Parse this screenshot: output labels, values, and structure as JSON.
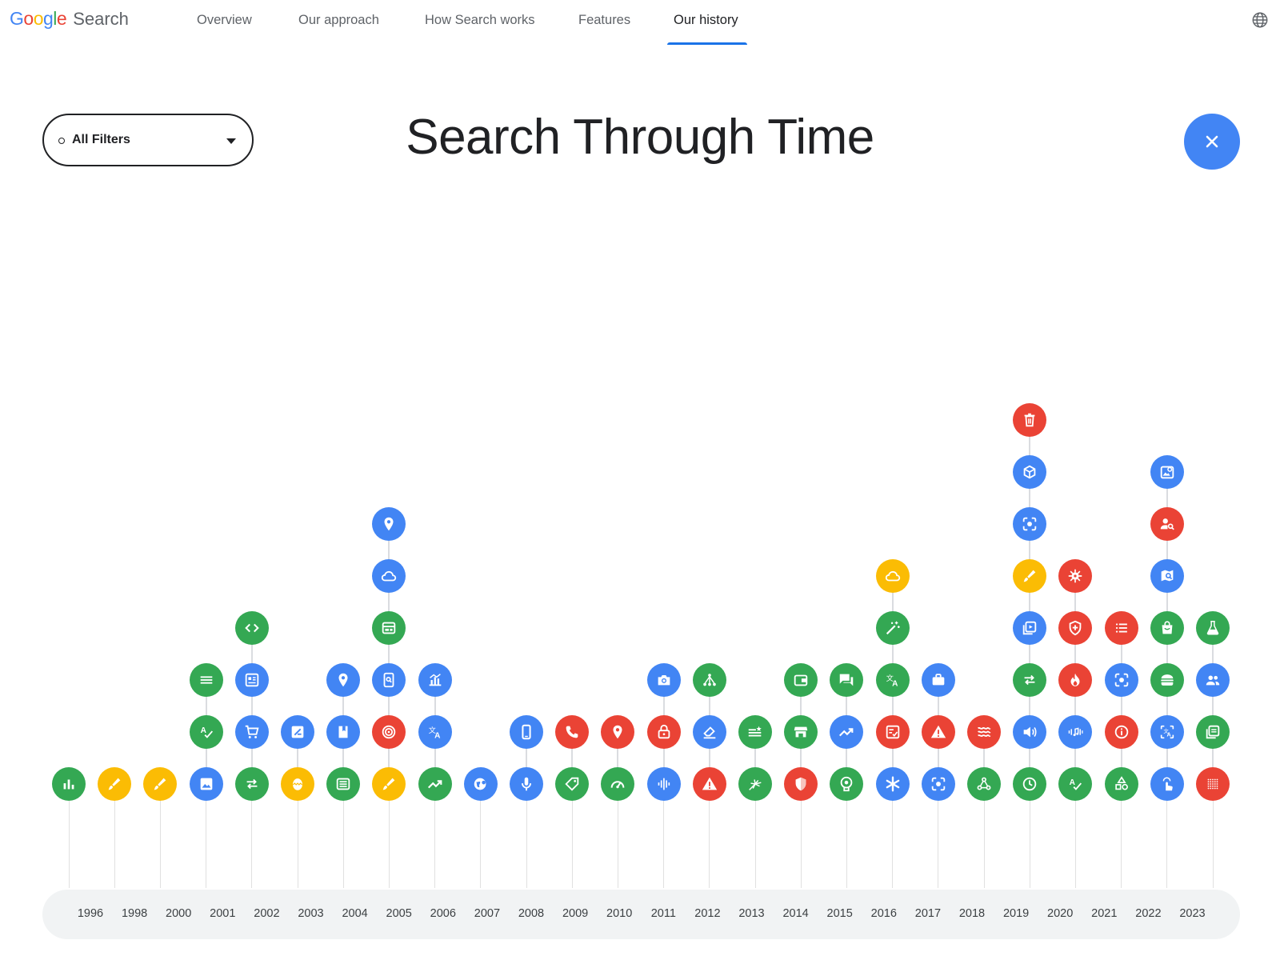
{
  "header": {
    "brand": {
      "letters": [
        "G",
        "o",
        "o",
        "g",
        "l",
        "e"
      ],
      "colors": [
        "#4285f4",
        "#ea4335",
        "#fbbc04",
        "#4285f4",
        "#34a853",
        "#ea4335"
      ],
      "product": "Search"
    },
    "nav": [
      {
        "label": "Overview",
        "active": false
      },
      {
        "label": "Our approach",
        "active": false
      },
      {
        "label": "How Search works",
        "active": false
      },
      {
        "label": "Features",
        "active": false
      },
      {
        "label": "Our history",
        "active": true
      }
    ],
    "accent": "#1a73e8",
    "globe_icon": "globe-icon"
  },
  "filter": {
    "label": "All Filters",
    "icon": "chevron-down-icon"
  },
  "page_title": "Search Through Time",
  "close_icon": "close-icon",
  "colors": {
    "green": "#34a853",
    "blue": "#4285f4",
    "yellow": "#fbbc04",
    "red": "#ea4335"
  },
  "timeline": {
    "columns": [
      {
        "year": "1996",
        "icons": [
          {
            "name": "bar-chart",
            "color": "green"
          }
        ]
      },
      {
        "year": "1998",
        "icons": [
          {
            "name": "brush",
            "color": "yellow"
          }
        ]
      },
      {
        "year": "2000",
        "icons": [
          {
            "name": "brush",
            "color": "yellow"
          }
        ]
      },
      {
        "year": "2001",
        "icons": [
          {
            "name": "image",
            "color": "blue"
          },
          {
            "name": "spellcheck",
            "color": "green"
          },
          {
            "name": "menu",
            "color": "green"
          }
        ]
      },
      {
        "year": "2002",
        "icons": [
          {
            "name": "swap",
            "color": "green"
          },
          {
            "name": "cart",
            "color": "blue"
          },
          {
            "name": "article",
            "color": "blue"
          },
          {
            "name": "code",
            "color": "green"
          }
        ]
      },
      {
        "year": "2003",
        "icons": [
          {
            "name": "egg",
            "color": "yellow"
          },
          {
            "name": "edit-square",
            "color": "blue"
          }
        ]
      },
      {
        "year": "2004",
        "icons": [
          {
            "name": "newspaper",
            "color": "green"
          },
          {
            "name": "book",
            "color": "blue"
          },
          {
            "name": "location",
            "color": "blue"
          }
        ]
      },
      {
        "year": "2005",
        "icons": [
          {
            "name": "brush",
            "color": "yellow"
          },
          {
            "name": "target",
            "color": "red"
          },
          {
            "name": "phone-search",
            "color": "blue"
          },
          {
            "name": "web",
            "color": "green"
          },
          {
            "name": "cloud",
            "color": "blue"
          },
          {
            "name": "location",
            "color": "blue"
          }
        ]
      },
      {
        "year": "2006",
        "icons": [
          {
            "name": "trending",
            "color": "green"
          },
          {
            "name": "translate",
            "color": "blue"
          },
          {
            "name": "analytics",
            "color": "blue"
          }
        ]
      },
      {
        "year": "2007",
        "icons": [
          {
            "name": "globe-search",
            "color": "blue"
          }
        ]
      },
      {
        "year": "2008",
        "icons": [
          {
            "name": "mic",
            "color": "blue"
          },
          {
            "name": "smartphone",
            "color": "blue"
          }
        ]
      },
      {
        "year": "2009",
        "icons": [
          {
            "name": "tag",
            "color": "green"
          },
          {
            "name": "call",
            "color": "red"
          }
        ]
      },
      {
        "year": "2010",
        "icons": [
          {
            "name": "speed",
            "color": "green"
          },
          {
            "name": "location",
            "color": "red"
          }
        ]
      },
      {
        "year": "2011",
        "icons": [
          {
            "name": "waveform",
            "color": "blue"
          },
          {
            "name": "lock",
            "color": "red"
          },
          {
            "name": "camera",
            "color": "blue"
          }
        ]
      },
      {
        "year": "2012",
        "icons": [
          {
            "name": "warning",
            "color": "red"
          },
          {
            "name": "eraser",
            "color": "blue"
          },
          {
            "name": "hub",
            "color": "green"
          }
        ]
      },
      {
        "year": "2013",
        "icons": [
          {
            "name": "sparkle-burst",
            "color": "green"
          },
          {
            "name": "list-star",
            "color": "green"
          }
        ]
      },
      {
        "year": "2014",
        "icons": [
          {
            "name": "shield",
            "color": "red"
          },
          {
            "name": "store",
            "color": "green"
          },
          {
            "name": "wallet",
            "color": "green"
          }
        ]
      },
      {
        "year": "2015",
        "icons": [
          {
            "name": "psychology",
            "color": "green"
          },
          {
            "name": "trending",
            "color": "blue"
          },
          {
            "name": "chat",
            "color": "green"
          }
        ]
      },
      {
        "year": "2016",
        "icons": [
          {
            "name": "asterisk",
            "color": "blue"
          },
          {
            "name": "checklist",
            "color": "red"
          },
          {
            "name": "translate",
            "color": "green"
          },
          {
            "name": "magic-wand",
            "color": "green"
          },
          {
            "name": "cloud",
            "color": "yellow"
          }
        ]
      },
      {
        "year": "2017",
        "icons": [
          {
            "name": "lens",
            "color": "blue"
          },
          {
            "name": "warning",
            "color": "red"
          },
          {
            "name": "briefcase",
            "color": "blue"
          }
        ]
      },
      {
        "year": "2018",
        "icons": [
          {
            "name": "nodes",
            "color": "green"
          },
          {
            "name": "waves",
            "color": "red"
          }
        ]
      },
      {
        "year": "2019",
        "icons": [
          {
            "name": "clock",
            "color": "green"
          },
          {
            "name": "volume",
            "color": "blue"
          },
          {
            "name": "swap",
            "color": "green"
          },
          {
            "name": "video-library",
            "color": "blue"
          },
          {
            "name": "brush",
            "color": "yellow"
          },
          {
            "name": "lens",
            "color": "blue"
          },
          {
            "name": "cube",
            "color": "blue"
          },
          {
            "name": "delete",
            "color": "red"
          }
        ]
      },
      {
        "year": "2020",
        "icons": [
          {
            "name": "spellcheck",
            "color": "green"
          },
          {
            "name": "hum",
            "color": "blue"
          },
          {
            "name": "fire",
            "color": "red"
          },
          {
            "name": "shield-plus",
            "color": "red"
          },
          {
            "name": "virus",
            "color": "red"
          }
        ]
      },
      {
        "year": "2021",
        "icons": [
          {
            "name": "shapes",
            "color": "green"
          },
          {
            "name": "info",
            "color": "red"
          },
          {
            "name": "lens",
            "color": "blue"
          },
          {
            "name": "list",
            "color": "red"
          }
        ]
      },
      {
        "year": "2022",
        "icons": [
          {
            "name": "tap",
            "color": "blue"
          },
          {
            "name": "translate-lens",
            "color": "blue"
          },
          {
            "name": "burger",
            "color": "green"
          },
          {
            "name": "shopping-bag",
            "color": "green"
          },
          {
            "name": "map-search",
            "color": "blue"
          },
          {
            "name": "person-search",
            "color": "red"
          },
          {
            "name": "image-search",
            "color": "blue"
          }
        ]
      },
      {
        "year": "2023",
        "icons": [
          {
            "name": "grid-dots",
            "color": "red"
          },
          {
            "name": "library",
            "color": "green"
          },
          {
            "name": "people",
            "color": "blue"
          },
          {
            "name": "flask",
            "color": "green"
          }
        ]
      }
    ]
  }
}
